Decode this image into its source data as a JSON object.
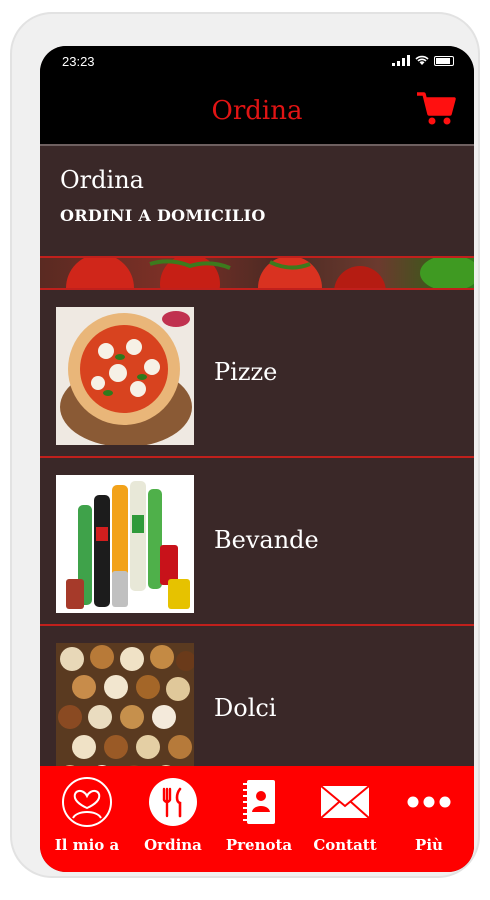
{
  "status_bar": {
    "time": "23:23"
  },
  "header": {
    "title": "Ordina"
  },
  "page": {
    "title": "Ordina",
    "subtitle": "ORDINI A DOMICILIO"
  },
  "menu": {
    "items": [
      {
        "label": "Pizze",
        "image": "pizza-image"
      },
      {
        "label": "Bevande",
        "image": "drinks-image"
      },
      {
        "label": "Dolci",
        "image": "pastries-image"
      }
    ]
  },
  "tabbar": {
    "tabs": [
      {
        "label": "Il mio a",
        "icon": "profile-heart-icon"
      },
      {
        "label": "Ordina",
        "icon": "fork-knife-icon"
      },
      {
        "label": "Prenota",
        "icon": "reservation-book-icon"
      },
      {
        "label": "Contatt",
        "icon": "envelope-icon"
      },
      {
        "label": "Più",
        "icon": "more-dots-icon"
      }
    ]
  },
  "colors": {
    "accent_red": "#ff0000",
    "title_red": "#e11414",
    "background_brown": "#3a2828",
    "divider_red": "#c0201c"
  }
}
